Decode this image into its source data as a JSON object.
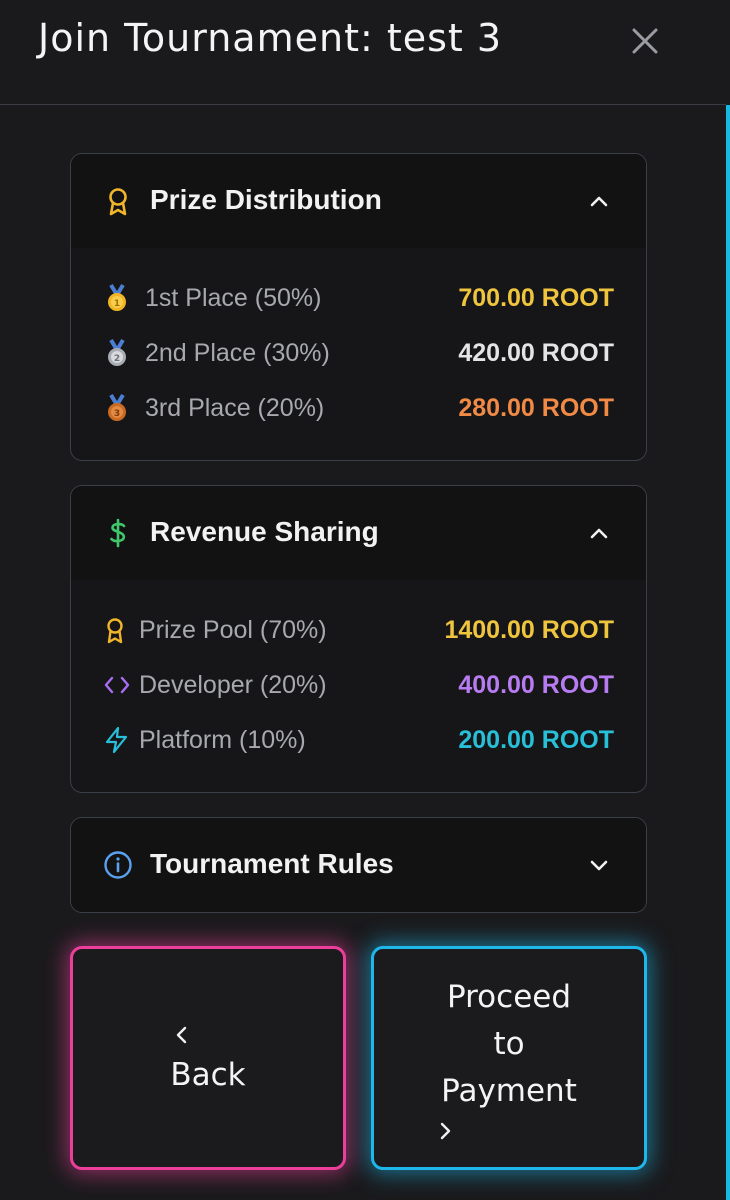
{
  "dialog": {
    "title": "Join Tournament: test 3",
    "close_icon": "close-icon"
  },
  "prize_distribution": {
    "title": "Prize Distribution",
    "icon": "award-icon",
    "expanded": true,
    "rows": [
      {
        "icon": "gold-medal-icon",
        "label": "1st Place (50%)",
        "value": "700.00 ROOT",
        "color": "#f0c53e"
      },
      {
        "icon": "silver-medal-icon",
        "label": "2nd Place (30%)",
        "value": "420.00 ROOT",
        "color": "#e4e4e6"
      },
      {
        "icon": "bronze-medal-icon",
        "label": "3rd Place (20%)",
        "value": "280.00 ROOT",
        "color": "#f08a45"
      }
    ]
  },
  "revenue_sharing": {
    "title": "Revenue Sharing",
    "icon": "dollar-icon",
    "expanded": true,
    "rows": [
      {
        "icon": "award-icon",
        "label": "Prize Pool (70%)",
        "value": "1400.00 ROOT",
        "color": "#f0c53e"
      },
      {
        "icon": "code-icon",
        "label": "Developer (20%)",
        "value": "400.00 ROOT",
        "color": "#b77cf2"
      },
      {
        "icon": "lightning-icon",
        "label": "Platform (10%)",
        "value": "200.00 ROOT",
        "color": "#28bfd8"
      }
    ]
  },
  "tournament_rules": {
    "title": "Tournament Rules",
    "icon": "info-icon",
    "expanded": false
  },
  "buttons": {
    "back_label": "Back",
    "proceed_line1": "Proceed",
    "proceed_line2": "to",
    "proceed_line3": "Payment"
  },
  "colors": {
    "back_accent": "#ec3f9b",
    "proceed_accent": "#1fb6ea"
  }
}
